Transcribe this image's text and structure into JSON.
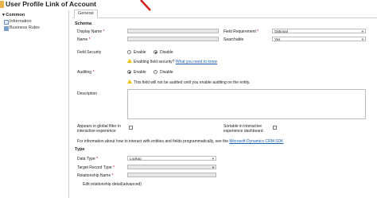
{
  "header": {
    "title": "User Profile Link of Account"
  },
  "tabs": [
    {
      "label": "General"
    }
  ],
  "sidebar": {
    "heading": "Common",
    "items": [
      {
        "label": "Information",
        "icon": "information-icon"
      },
      {
        "label": "Business Rules",
        "icon": "business-rules-icon"
      }
    ]
  },
  "schema": {
    "heading": "Schema",
    "display_name_label": "Display Name",
    "name_label": "Name",
    "field_requirement_label": "Field Requirement",
    "field_requirement_value": "Optional",
    "searchable_label": "Searchable",
    "searchable_value": "Yes",
    "field_security_label": "Field Security",
    "enable_label": "Enable",
    "disable_label": "Disable",
    "field_security_warning": "Enabling field security?",
    "field_security_link": "What you need to know",
    "auditing_label": "Auditing",
    "auditing_warning": "This field will not be audited until you enable auditing on the entity.",
    "description_label": "Description",
    "global_filter_label_1": "Appears in global filter in",
    "global_filter_label_2": "interactive experience",
    "sortable_label_1": "Sortable in interactive",
    "sortable_label_2": "experience dashboard",
    "info_text": "For information about how to interact with entities and fields programmatically, see the",
    "info_link": "Microsoft Dynamics CRM SDK"
  },
  "type": {
    "heading": "Type",
    "data_type_label": "Data Type",
    "data_type_value": "Lookup",
    "target_record_label": "Target Record Type",
    "relationship_label": "Relationship Name",
    "edit_relationship": "Edit relationship detail(advanced)"
  },
  "colors": {
    "required": "#cc0000",
    "link": "#1a5dad",
    "warning": "#f2c200",
    "accent": "#e8b34b"
  }
}
